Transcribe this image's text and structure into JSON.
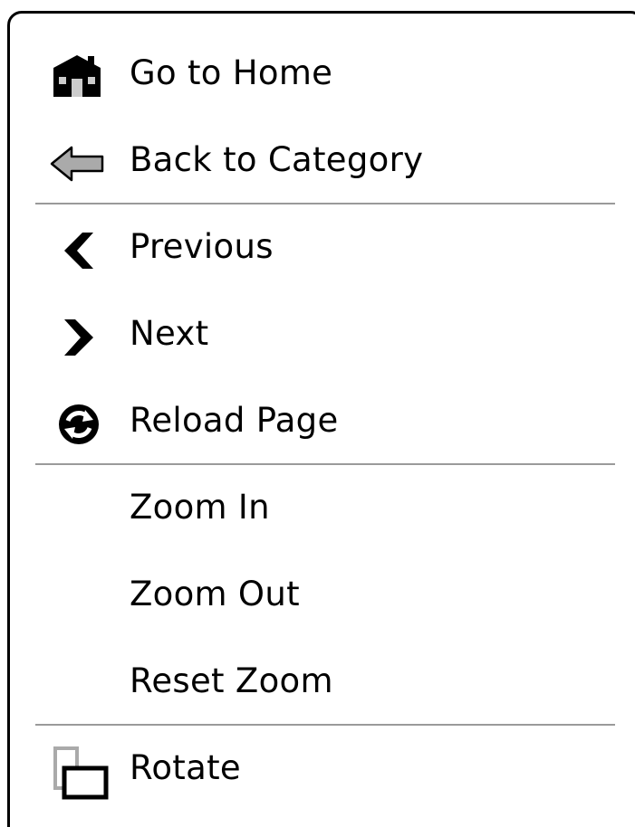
{
  "menu": {
    "items": [
      {
        "label": "Go to Home",
        "icon": "home-icon"
      },
      {
        "label": "Back to Category",
        "icon": "back-arrow-icon"
      },
      {
        "label": "Previous",
        "icon": "chevron-left-icon"
      },
      {
        "label": "Next",
        "icon": "chevron-right-icon"
      },
      {
        "label": "Reload Page",
        "icon": "reload-icon"
      },
      {
        "label": "Zoom In",
        "icon": ""
      },
      {
        "label": "Zoom Out",
        "icon": ""
      },
      {
        "label": "Reset Zoom",
        "icon": ""
      },
      {
        "label": "Rotate",
        "icon": "rotate-icon"
      }
    ]
  },
  "colors": {
    "border": "#000000",
    "divider": "#9a9a9a",
    "text": "#000000",
    "icon_gray": "#aaaaaa"
  }
}
